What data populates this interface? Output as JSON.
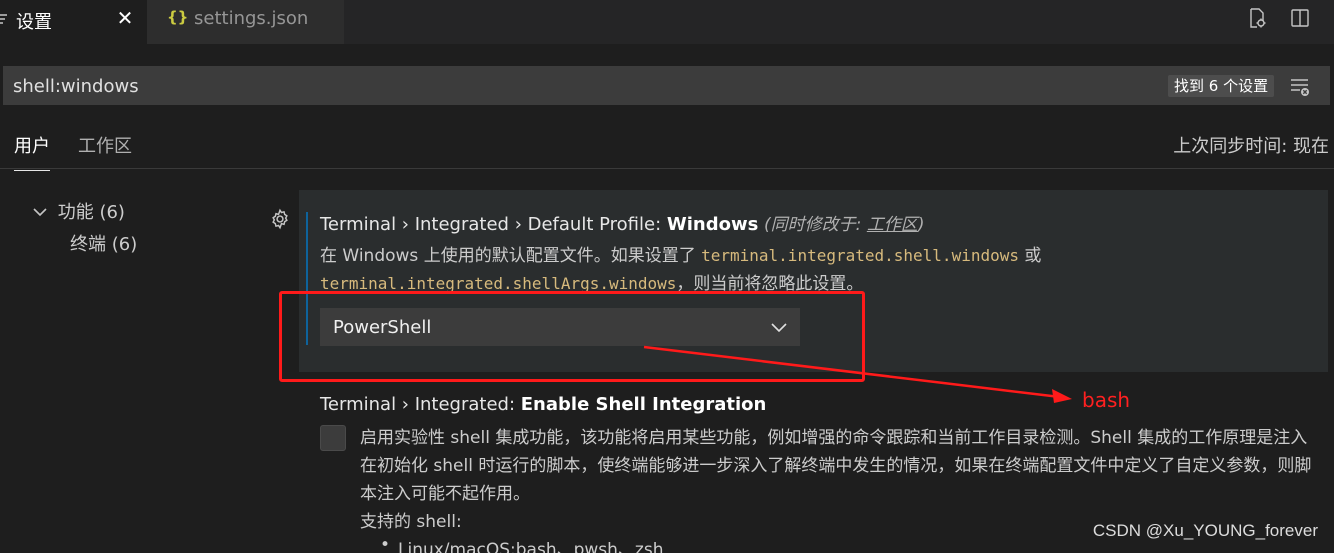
{
  "tabs": [
    {
      "label": "设置",
      "active": true,
      "icon": "settings-icon"
    },
    {
      "label": "settings.json",
      "active": false,
      "icon": "json-braces-icon"
    }
  ],
  "tab_close_glyph": "✕",
  "json_icon_glyph": "{}",
  "search": {
    "value": "shell:windows",
    "result_count": "找到 6 个设置"
  },
  "scopes": {
    "user": "用户",
    "workspace": "工作区",
    "sync_time": "上次同步时间: 现在"
  },
  "toc": {
    "features": "功能 (6)",
    "terminal": "终端 (6)"
  },
  "setting_profile": {
    "category": "Terminal › Integrated › Default Profile: ",
    "name": "Windows",
    "modified_prefix": "(同时修改于: ",
    "modified_scope": "工作区",
    "modified_suffix": ")",
    "desc_1": "在 Windows 上使用的默认配置文件。如果设置了 ",
    "code_1": "terminal.integrated.shell.windows",
    "desc_2": " 或",
    "code_2": "terminal.integrated.shellArgs.windows",
    "desc_3": "，则当前将忽略此设置。",
    "value": "PowerShell"
  },
  "annotation": {
    "label": "bash",
    "color": "#ff1a1a"
  },
  "setting_shell_integration": {
    "category": "Terminal › Integrated: ",
    "name": "Enable Shell Integration",
    "checked": false,
    "desc": "启用实验性 shell 集成功能，该功能将启用某些功能，例如增强的命令跟踪和当前工作目录检测。Shell 集成的工作原理是注入在初始化 shell 时运行的脚本，使终端能够进一步深入了解终端中发生的情况，如果在终端配置文件中定义了自定义参数，则脚本注入可能不起作用。",
    "supported_label": "支持的 shell:",
    "bullet_1": "Linux/macOS:bash、pwsh、zsh"
  },
  "watermark": "CSDN @Xu_YOUNG_forever",
  "colors": {
    "accent": "#0e639c",
    "code": "#d7ba7d",
    "json_icon": "#cbcb41"
  }
}
